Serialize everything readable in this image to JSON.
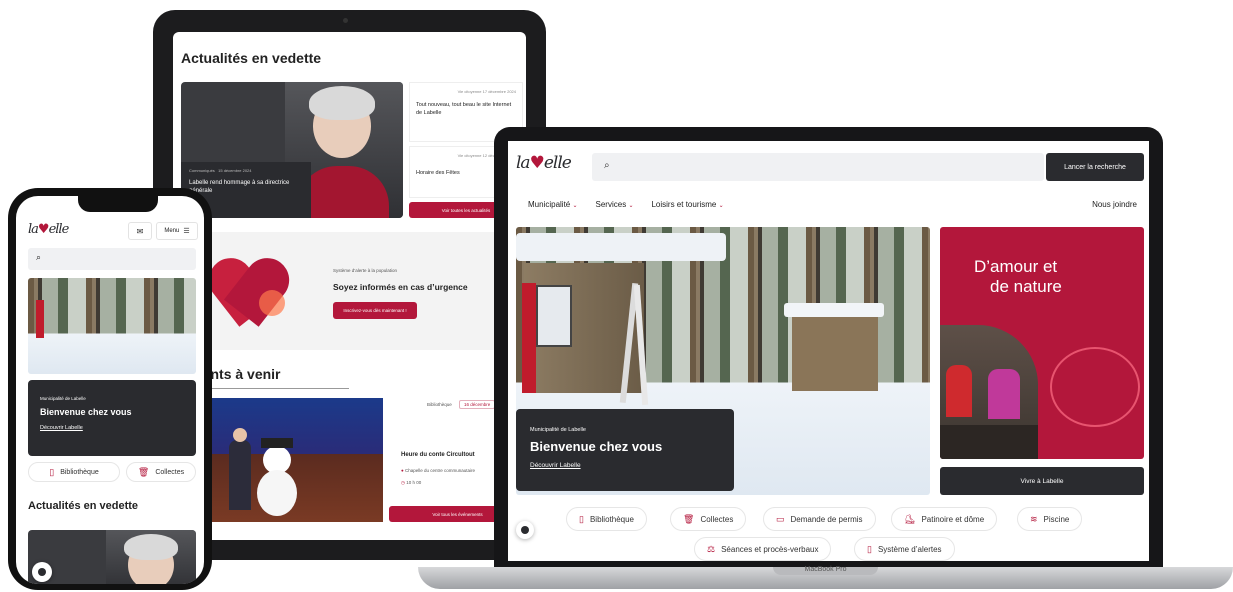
{
  "brand": {
    "logo_text": "labelle",
    "accent": "#b3173b",
    "dark": "#2a2b2f"
  },
  "laptop": {
    "device_label": "MacBook Pro",
    "search_button": "Lancer la recherche",
    "search_icon": "search-icon",
    "nav": [
      {
        "label": "Municipalité"
      },
      {
        "label": "Services"
      },
      {
        "label": "Loisirs et tourisme"
      }
    ],
    "nav_right": "Nous joindre",
    "hero": {
      "eyebrow": "Municipalité de Labelle",
      "title": "Bienvenue chez vous",
      "link": "Découvrir Labelle"
    },
    "promo": {
      "title_line1": "D’amour et",
      "title_line2": "de nature",
      "button": "Vivre à Labelle"
    },
    "quick_links": [
      {
        "label": "Bibliothèque",
        "icon": "book-icon"
      },
      {
        "label": "Collectes",
        "icon": "trash-icon"
      },
      {
        "label": "Demande de permis",
        "icon": "document-icon"
      },
      {
        "label": "Patinoire et dôme",
        "icon": "skate-icon"
      },
      {
        "label": "Piscine",
        "icon": "pool-icon"
      },
      {
        "label": "Séances et procès-verbaux",
        "icon": "gavel-icon"
      },
      {
        "label": "Système d’alertes",
        "icon": "alert-icon"
      }
    ]
  },
  "tablet": {
    "news_title": "Actualités en vedette",
    "feature_meta_category": "Communiqués",
    "feature_meta_date": "15 décembre 2024",
    "feature_title": "Labelle rend hommage à sa directrice générale",
    "side_news": [
      {
        "category": "Vie citoyenne",
        "date": "17 décembre 2024",
        "title": "Tout nouveau, tout beau le site Internet de Labelle"
      },
      {
        "category": "Vie citoyenne",
        "date": "12 décembre 2024",
        "title": "Horaire des Fêtes"
      }
    ],
    "all_news_button": "Voir toutes les actualités",
    "alert_eyebrow": "Système d’alerte à la population",
    "alert_title": "Soyez informés en cas d’urgence",
    "alert_button": "Inscrivez-vous dès maintenant !",
    "events_title": "Événements à venir",
    "event_filter_a": "Bibliothèque",
    "event_filter_b": "16 décembre",
    "event_title": "Heure du conte Circultout",
    "event_place": "Chapelle du centre communautaire",
    "event_time": "10 h 00",
    "all_events_button": "Voir tous les événements"
  },
  "phone": {
    "menu_label": "Menu",
    "hero": {
      "eyebrow": "Municipalité de Labelle",
      "title": "Bienvenue chez vous",
      "link": "Découvrir Labelle"
    },
    "quick_links": [
      {
        "label": "Bibliothèque",
        "icon": "book-icon"
      },
      {
        "label": "Collectes",
        "icon": "trash-icon"
      }
    ],
    "news_title": "Actualités en vedette"
  }
}
